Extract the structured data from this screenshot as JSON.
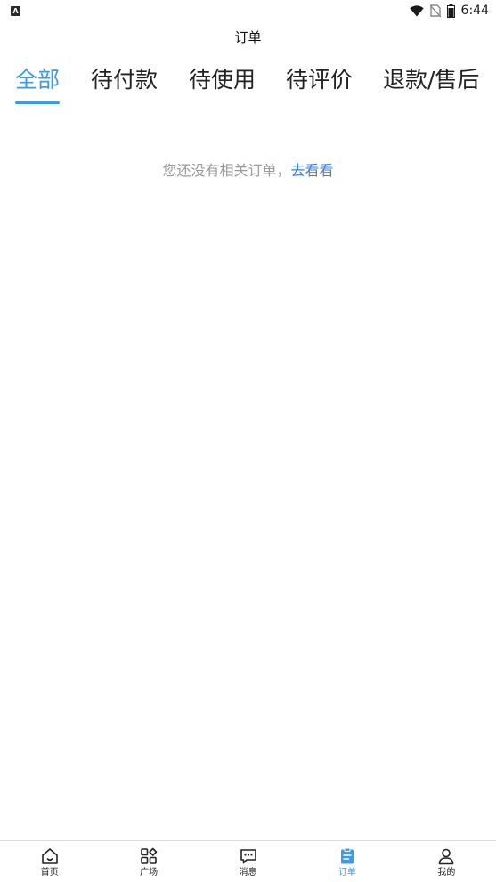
{
  "status_bar": {
    "notification_letter": "A",
    "time": "6:44"
  },
  "header": {
    "title": "订单"
  },
  "tabs": [
    {
      "label": "全部",
      "active": true
    },
    {
      "label": "待付款",
      "active": false
    },
    {
      "label": "待使用",
      "active": false
    },
    {
      "label": "待评价",
      "active": false
    },
    {
      "label": "退款/售后",
      "active": false
    }
  ],
  "empty_state": {
    "message": "您还没有相关订单，",
    "link": "去看看"
  },
  "bottom_nav": [
    {
      "label": "首页",
      "icon": "home-icon",
      "active": false
    },
    {
      "label": "广场",
      "icon": "grid-icon",
      "active": false
    },
    {
      "label": "消息",
      "icon": "message-icon",
      "active": false
    },
    {
      "label": "订单",
      "icon": "order-icon",
      "active": true
    },
    {
      "label": "我的",
      "icon": "user-icon",
      "active": false
    }
  ],
  "colors": {
    "accent": "#3c9ae6",
    "link": "#3c7fd6",
    "muted_text": "#9a9a9a"
  }
}
